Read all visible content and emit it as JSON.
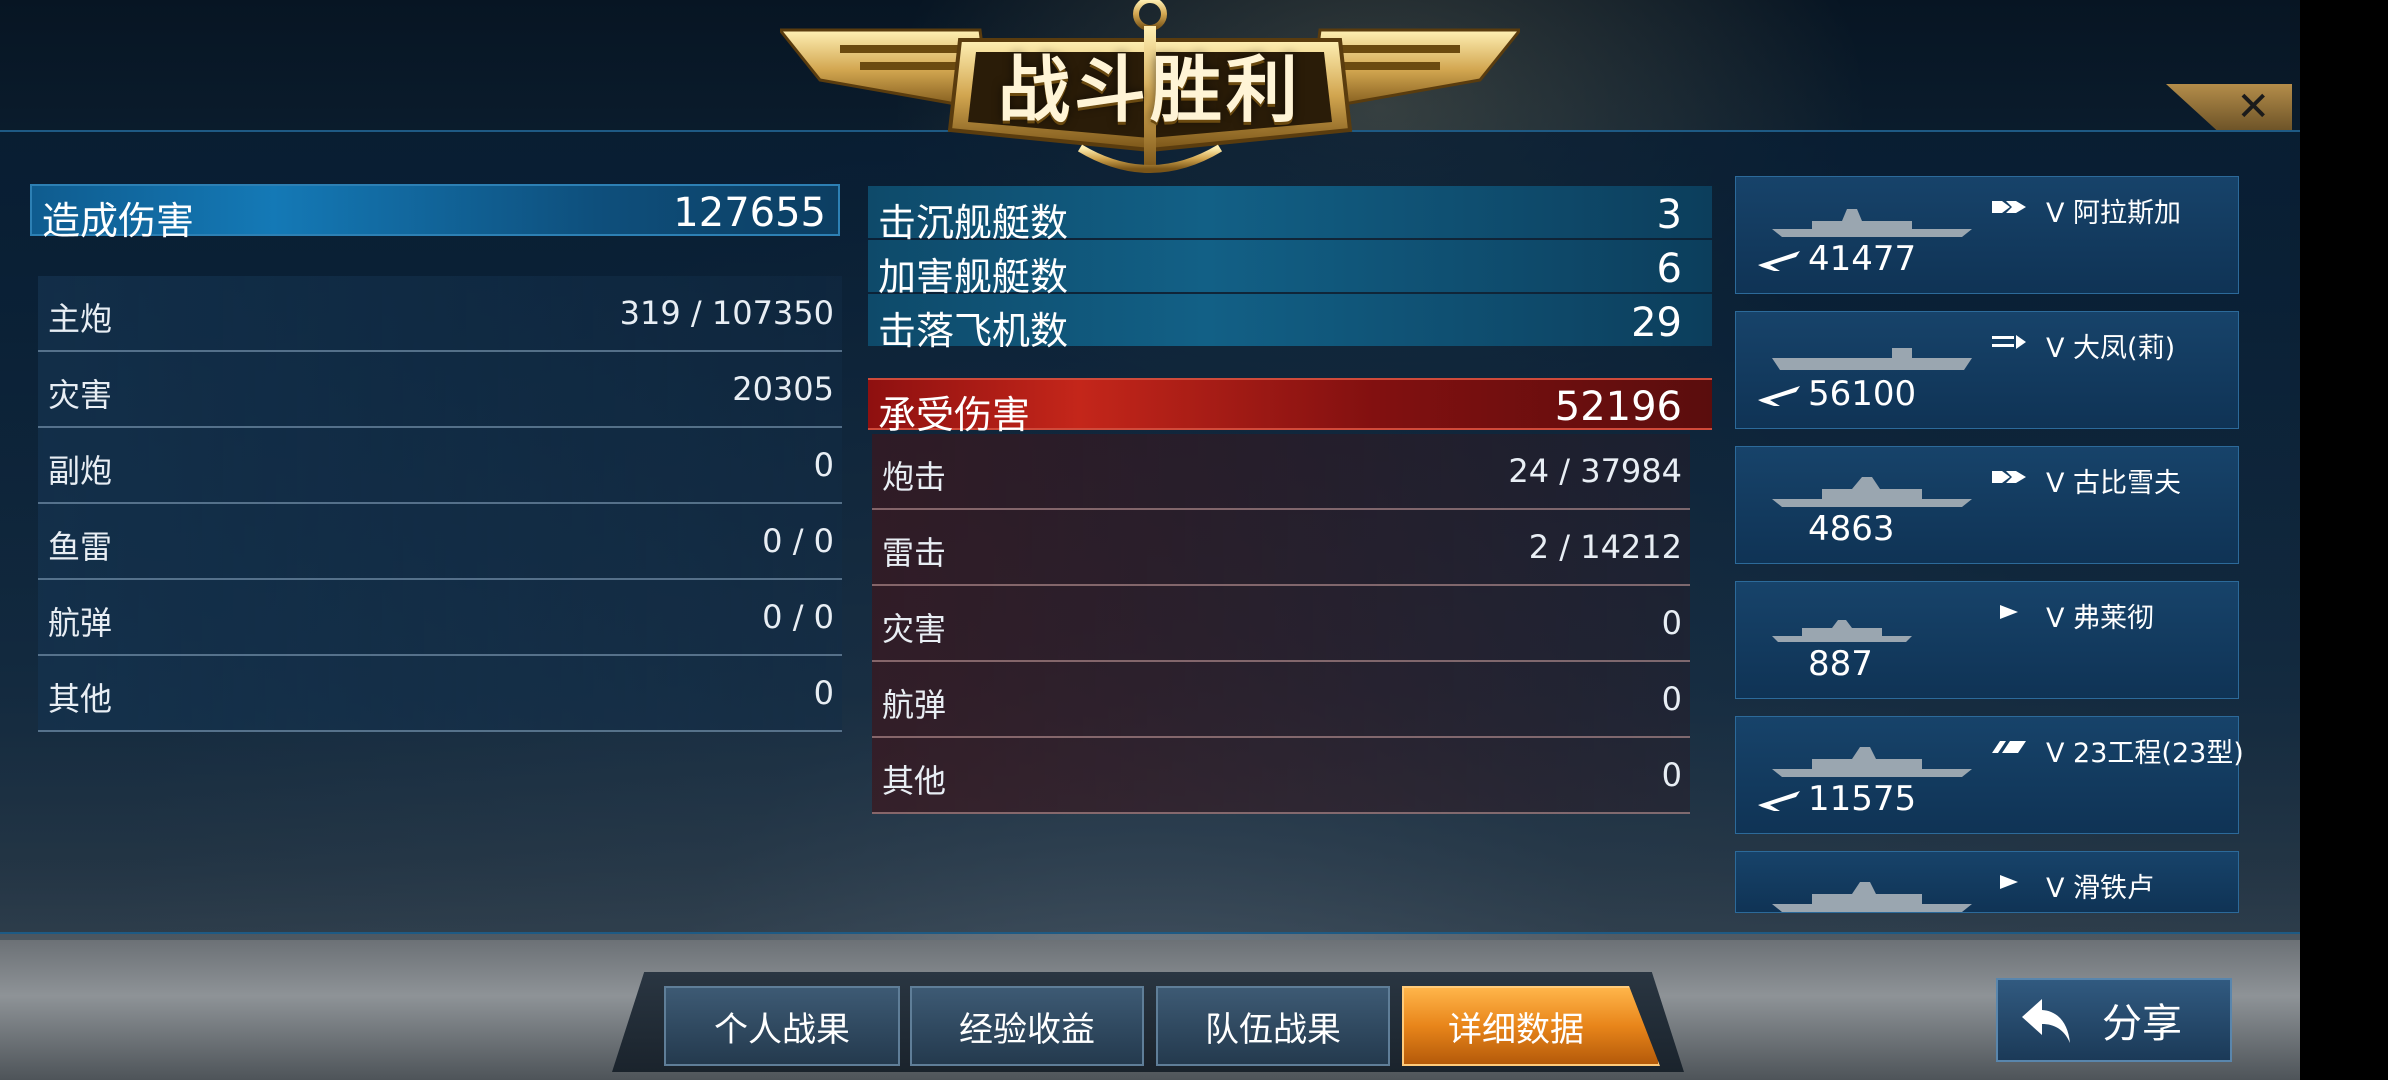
{
  "header": {
    "title": "战斗胜利",
    "close_icon": "close-icon"
  },
  "damage_dealt": {
    "label": "造成伤害",
    "value": "127655",
    "rows": [
      {
        "label": "主炮",
        "value": "319 / 107350"
      },
      {
        "label": "灾害",
        "value": "20305"
      },
      {
        "label": "副炮",
        "value": "0"
      },
      {
        "label": "鱼雷",
        "value": "0 / 0"
      },
      {
        "label": "航弹",
        "value": "0 / 0"
      },
      {
        "label": "其他",
        "value": "0"
      }
    ]
  },
  "battle_stats": [
    {
      "label": "击沉舰艇数",
      "value": "3"
    },
    {
      "label": "加害舰艇数",
      "value": "6"
    },
    {
      "label": "击落飞机数",
      "value": "29"
    }
  ],
  "damage_taken": {
    "label": "承受伤害",
    "value": "52196",
    "rows": [
      {
        "label": "炮击",
        "value": "24 / 37984"
      },
      {
        "label": "雷击",
        "value": "2 / 14212"
      },
      {
        "label": "灾害",
        "value": "0"
      },
      {
        "label": "航弹",
        "value": "0"
      },
      {
        "label": "其他",
        "value": "0"
      }
    ]
  },
  "ships": [
    {
      "name": "V 阿拉斯加",
      "damage": "41477",
      "has_plane": true,
      "type_icon": "cruiser-icon"
    },
    {
      "name": "V 大凤(莉)",
      "damage": "56100",
      "has_plane": true,
      "type_icon": "carrier-icon"
    },
    {
      "name": "V 古比雪夫",
      "damage": "4863",
      "has_plane": false,
      "type_icon": "cruiser-icon"
    },
    {
      "name": "V 弗莱彻",
      "damage": "887",
      "has_plane": false,
      "type_icon": "destroyer-icon"
    },
    {
      "name": "V 23工程(23型)",
      "damage": "11575",
      "has_plane": true,
      "type_icon": "battleship-icon"
    },
    {
      "name": "V 滑铁卢",
      "damage": "",
      "has_plane": false,
      "type_icon": "destroyer-icon"
    }
  ],
  "tabs": [
    {
      "label": "个人战果",
      "active": false
    },
    {
      "label": "经验收益",
      "active": false
    },
    {
      "label": "队伍战果",
      "active": false
    },
    {
      "label": "详细数据",
      "active": true
    }
  ],
  "share": {
    "label": "分享"
  },
  "colors": {
    "accent_gold": "#c9a35a",
    "active_tab": "#e8851a",
    "damage_taken_red": "#c4261a",
    "panel_blue": "#1479b6"
  }
}
